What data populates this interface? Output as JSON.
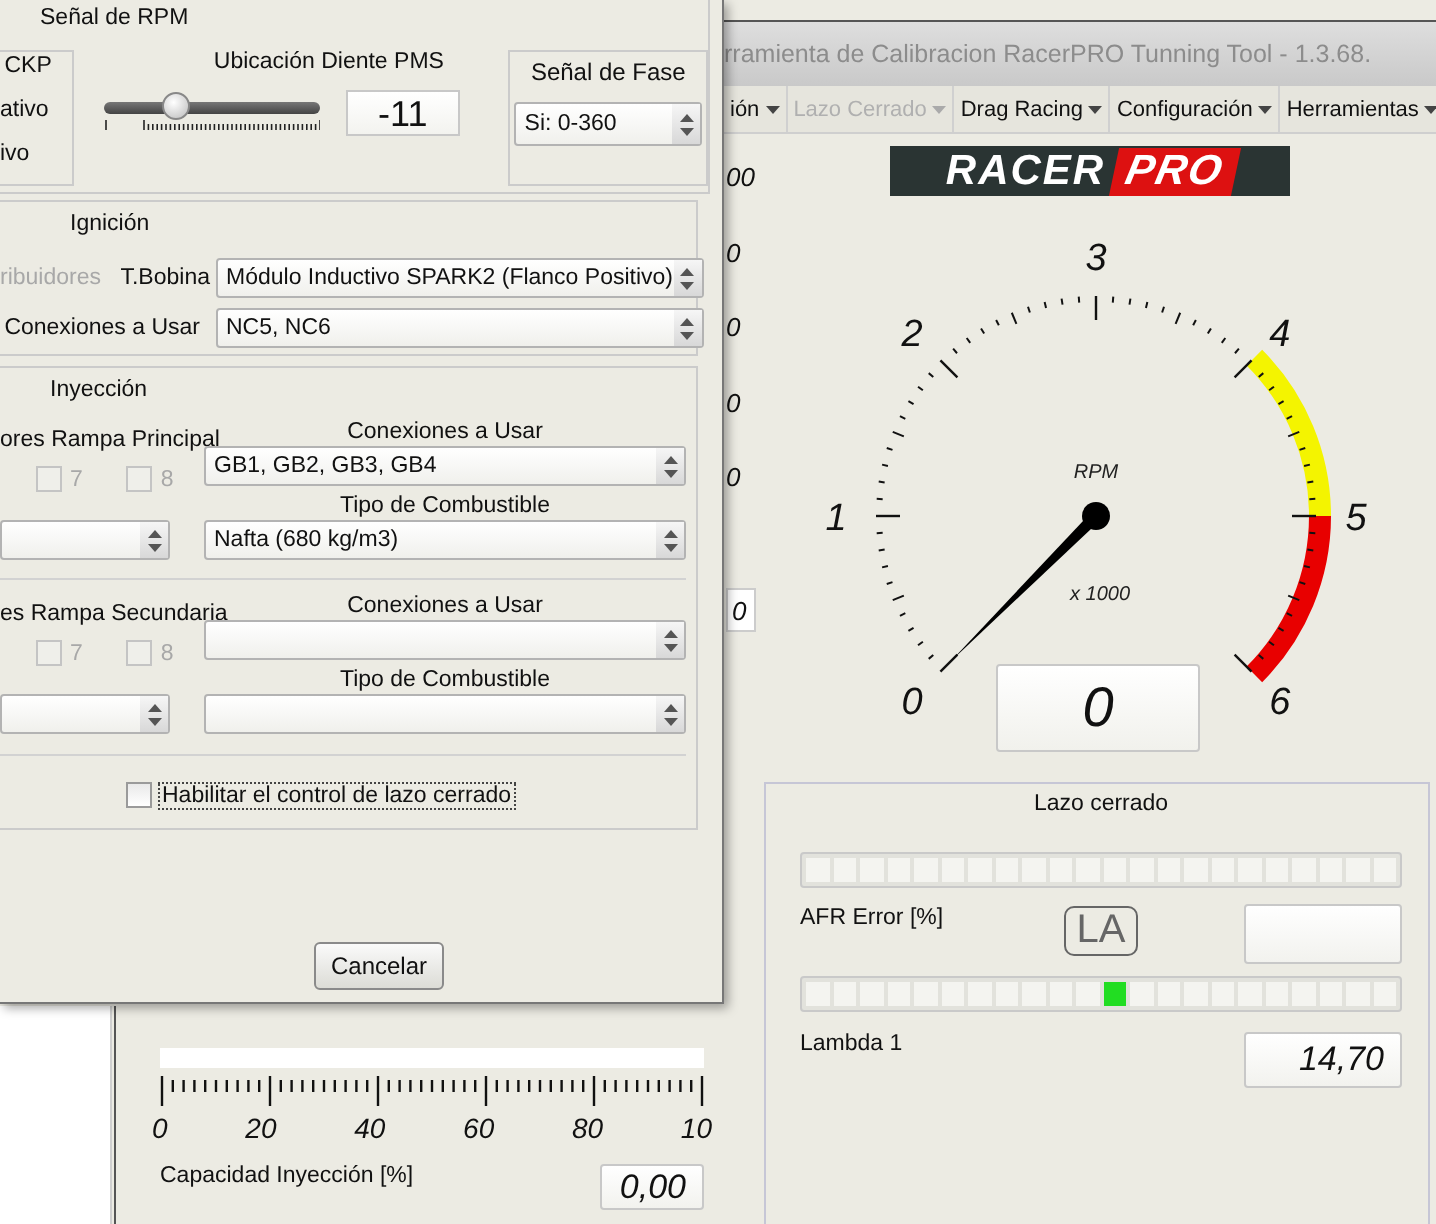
{
  "main_window": {
    "title": "rramienta de Calibracion RacerPRO Tunning Tool - 1.3.68.",
    "menu": [
      {
        "label": "ión",
        "disabled": false
      },
      {
        "label": "Lazo Cerrado",
        "disabled": true
      },
      {
        "label": "Drag Racing",
        "disabled": false
      },
      {
        "label": "Configuración",
        "disabled": false
      },
      {
        "label": "Herramientas",
        "disabled": false
      }
    ],
    "logo": {
      "part_1": "RACER",
      "part_2": "PRO"
    },
    "scale_fragments": [
      {
        "kind": "plain",
        "text": "00"
      },
      {
        "kind": "plain",
        "text": "0"
      },
      {
        "kind": "plain",
        "text": "0"
      },
      {
        "kind": "plain",
        "text": "0"
      },
      {
        "kind": "plain",
        "text": "0"
      },
      {
        "kind": "box",
        "text": "0"
      }
    ],
    "rpm_gauge": {
      "label": "RPM",
      "multiplier": "x 1000",
      "ticks": [
        "0",
        "1",
        "2",
        "3",
        "4",
        "5",
        "6"
      ],
      "reading": "0"
    },
    "injection_panel": {
      "scale_labels": [
        "0",
        "20",
        "40",
        "60",
        "80",
        "10"
      ],
      "label": "Capacidad Inyección [%]",
      "value": "0,00"
    },
    "closed_loop": {
      "title": "Lazo cerrado",
      "afr_label": "AFR Error [%]",
      "badge": "LA",
      "lambda_bar": {
        "level": 0.5
      },
      "lambda_label": "Lambda 1",
      "lambda_value": "14,70"
    }
  },
  "dialog": {
    "rpm_group": {
      "title": "Señal de RPM",
      "ckp": {
        "title": "CKP",
        "options": [
          "ativo",
          "ivo"
        ]
      },
      "tdc_label": "Ubicación Diente PMS",
      "tdc_slider": {
        "level": 0.33
      },
      "tdc_value": "-11",
      "phase": {
        "title": "Señal de Fase",
        "value": "Si: 0-360"
      }
    },
    "ignition": {
      "title": "Ignición",
      "distributors": {
        "label": "ribuidores",
        "disabled": true
      },
      "coil_label": "T.Bobina",
      "coil_value": "Módulo Inductivo SPARK2 (Flanco Positivo)",
      "connections_label": "Conexiones a Usar",
      "connections_value": "NC5, NC6"
    },
    "injection": {
      "title": "Inyección",
      "ramps": [
        {
          "label": "ores Rampa Principal",
          "checks": [
            {
              "label": "7",
              "checked": false,
              "disabled": true
            },
            {
              "label": "8",
              "checked": false,
              "disabled": true
            }
          ],
          "connections_label": "Conexiones a Usar",
          "connections_value": "GB1, GB2, GB3, GB4",
          "fuel_label": "Tipo de Combustible",
          "fuel_value": "Nafta (680 kg/m3)"
        },
        {
          "label": "es Rampa Secundaria",
          "checks": [
            {
              "label": "7",
              "checked": false,
              "disabled": true
            },
            {
              "label": "8",
              "checked": false,
              "disabled": true
            }
          ],
          "connections_label": "Conexiones a Usar",
          "fuel_label": "Tipo de Combustible"
        }
      ]
    },
    "closed_loop_check": {
      "label": "Habilitar el control de lazo cerrado",
      "checked": false
    },
    "cancel_button": "Cancelar"
  }
}
